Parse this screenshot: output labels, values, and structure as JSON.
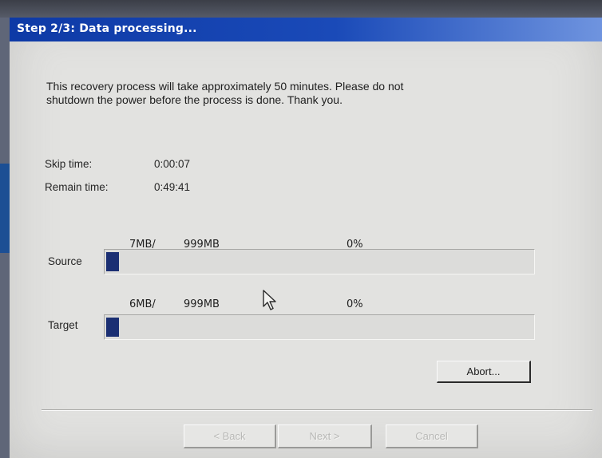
{
  "window": {
    "title": "Step 2/3: Data processing..."
  },
  "message": {
    "line1": "This recovery process will take approximately 50 minutes.  Please do not",
    "line2": "shutdown the power before the process is done.  Thank you."
  },
  "times": {
    "skip_label": "Skip time:",
    "skip_value": "0:00:07",
    "remain_label": "Remain time:",
    "remain_value": "0:49:41"
  },
  "source": {
    "label": "Source",
    "done": "7MB/",
    "total": "999MB",
    "percent": "0%",
    "progress_fraction": 0.007
  },
  "target": {
    "label": "Target",
    "done": "6MB/",
    "total": "999MB",
    "percent": "0%",
    "progress_fraction": 0.006
  },
  "buttons": {
    "abort": "Abort...",
    "back": "< Back",
    "next": "Next >",
    "cancel": "Cancel"
  },
  "colors": {
    "title_bar": "#1a4ab8",
    "progress_fill": "#1b2f73"
  },
  "cursor_icon": "arrow-pointer-icon"
}
